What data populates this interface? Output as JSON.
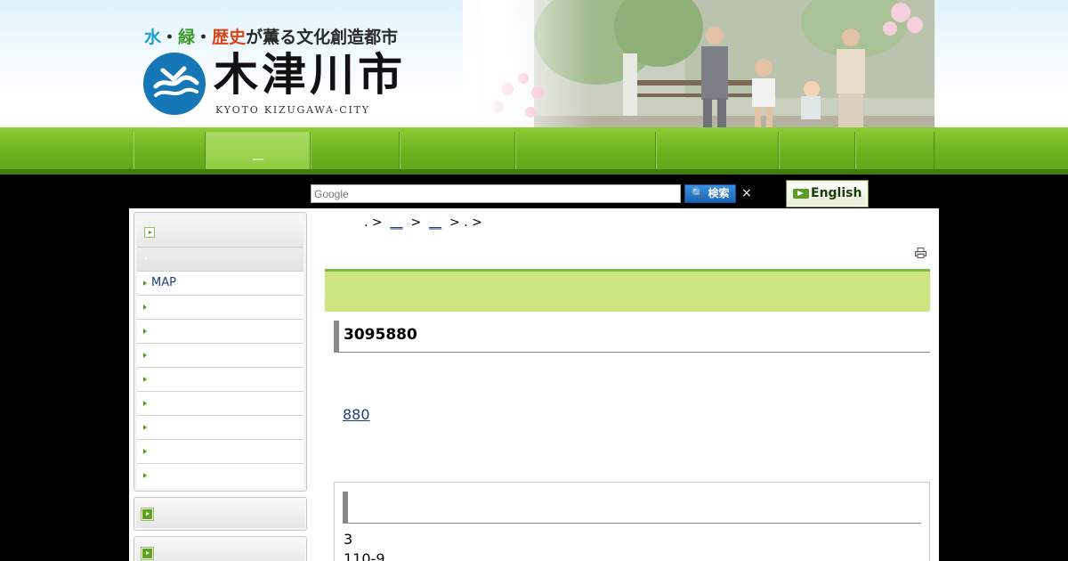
{
  "header": {
    "tagline_parts": [
      "水",
      "・",
      "緑",
      "・",
      "歴史",
      "が薫る文化創造都市"
    ],
    "city_name": "木津川市",
    "city_subtitle": "KYOTO KIZUGAWA-CITY",
    "logo_icon": "city-emblem-icon",
    "photo_icon": "family-photo"
  },
  "nav": {
    "items": [
      "",
      "—",
      "",
      "",
      "",
      "",
      "",
      ""
    ],
    "active_index": 1
  },
  "search": {
    "placeholder": "Google",
    "button_label": "🔍 検索",
    "clear_label": "×"
  },
  "language": {
    "english_label": "English"
  },
  "breadcrumb": {
    "parts": [
      ".",
      ">",
      "__",
      ">",
      "__",
      ">",
      ".",
      ">"
    ]
  },
  "sidebar": {
    "items": [
      "MAP",
      "",
      "",
      "",
      "",
      "",
      "",
      ""
    ]
  },
  "main": {
    "heading": "3095880",
    "link": "880",
    "info_line1": "3",
    "info_line2": "110-9"
  },
  "colors": {
    "accent_green": "#7fb940",
    "bar_green": "#cde67f",
    "link_blue": "#1a3d8a"
  }
}
